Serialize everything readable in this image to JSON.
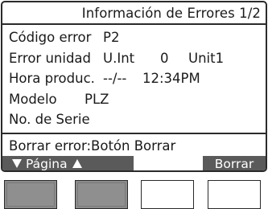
{
  "header": {
    "title": "Información de Errores 1/2"
  },
  "info": {
    "error_code": {
      "label": "Código error",
      "value": "P2"
    },
    "error_unit": {
      "label": "Error unidad",
      "unit": "U.Int",
      "number": "0",
      "name": "Unit1"
    },
    "time": {
      "label": "Hora produc.",
      "date": "--/--",
      "clock": "12:34PM"
    },
    "model": {
      "label": "Modelo",
      "value": "PLZ"
    },
    "serial": {
      "label": "No. de Serie"
    }
  },
  "hint": "Borrar error:Botón Borrar",
  "function_bar": {
    "page_label": "Página",
    "clear_label": "Borrar"
  },
  "buttons": [
    {
      "id": "F1",
      "pressed": true
    },
    {
      "id": "F2",
      "pressed": true
    },
    {
      "id": "F3",
      "pressed": false
    },
    {
      "id": "F4",
      "pressed": false
    }
  ],
  "colors": {
    "screen_border": "#2a2a2a",
    "function_key_bg": "#5a5a5a",
    "pressed_button": "#8c8c8c"
  }
}
